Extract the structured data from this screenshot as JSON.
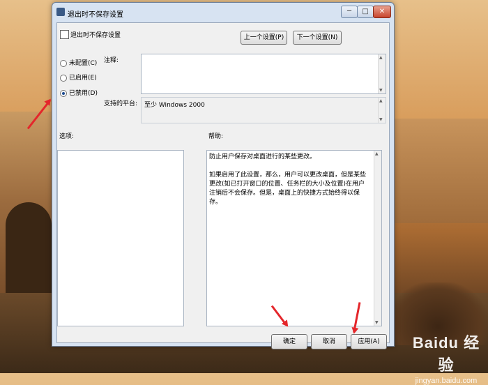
{
  "window": {
    "title": "退出时不保存设置",
    "controls": {
      "minimize": "─",
      "maximize": "□",
      "close": "✕"
    },
    "icon": "policy-settings-icon"
  },
  "header": {
    "title": "退出时不保存设置",
    "prev_button": "上一个设置(P)",
    "next_button": "下一个设置(N)"
  },
  "state": {
    "options": [
      {
        "label": "未配置(C)",
        "checked": false
      },
      {
        "label": "已启用(E)",
        "checked": false
      },
      {
        "label": "已禁用(D)",
        "checked": true
      }
    ]
  },
  "comment": {
    "label": "注释:",
    "value": ""
  },
  "platform": {
    "label": "支持的平台:",
    "value": "至少 Windows 2000"
  },
  "options_panel": {
    "label": "选项:"
  },
  "help": {
    "label": "帮助:",
    "paragraphs": [
      "防止用户保存对桌面进行的某些更改。",
      "如果启用了此设置，那么，用户可以更改桌面，但是某些更改(如已打开窗口的位置、任务栏的大小及位置)在用户注销后不会保存。但是，桌面上的快捷方式始终得以保存。"
    ]
  },
  "footer": {
    "ok": "确定",
    "cancel": "取消",
    "apply": "应用(A)"
  },
  "watermark": {
    "main": "Baidu 经验",
    "sub": "jingyan.baidu.com"
  },
  "colors": {
    "arrow": "#e4262b",
    "accent": "#1d4c91"
  }
}
